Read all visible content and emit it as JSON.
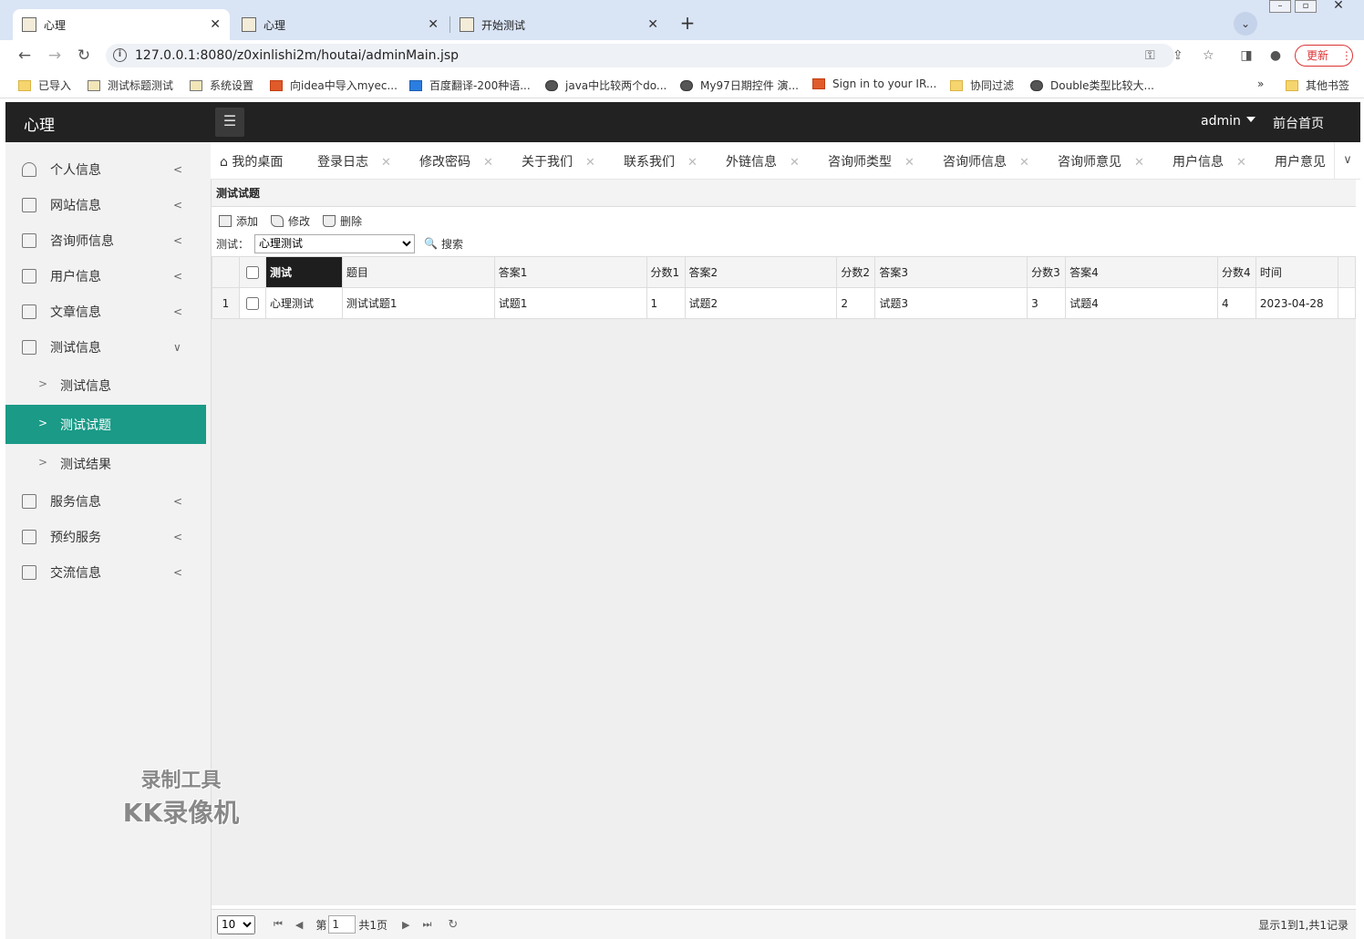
{
  "browser": {
    "tabs": [
      {
        "title": "心理",
        "close": "✕"
      },
      {
        "title": "心理",
        "close": "✕"
      },
      {
        "title": "开始测试",
        "close": "✕"
      }
    ],
    "url": "127.0.0.1:8080/z0xinlishi2m/houtai/adminMain.jsp",
    "update_label": "更新",
    "bookmarks": [
      "已导入",
      "测试标题测试",
      "系统设置",
      "向idea中导入myec...",
      "百度翻译-200种语...",
      "java中比较两个do...",
      "My97日期控件 演...",
      "Sign in to your IR...",
      "协同过滤",
      "Double类型比较大..."
    ],
    "bookmarks_overflow": "»",
    "other_bookmarks": "其他书签"
  },
  "app": {
    "title": "心理",
    "user": "admin",
    "home_link": "前台首页"
  },
  "sidebar": {
    "items": [
      {
        "label": "个人信息",
        "arrow": "<"
      },
      {
        "label": "网站信息",
        "arrow": "<"
      },
      {
        "label": "咨询师信息",
        "arrow": "<"
      },
      {
        "label": "用户信息",
        "arrow": "<"
      },
      {
        "label": "文章信息",
        "arrow": "<"
      },
      {
        "label": "测试信息",
        "arrow": "∨"
      },
      {
        "label": "服务信息",
        "arrow": "<"
      },
      {
        "label": "预约服务",
        "arrow": "<"
      },
      {
        "label": "交流信息",
        "arrow": "<"
      }
    ],
    "subitems": [
      {
        "label": "测试信息",
        "chev": ">"
      },
      {
        "label": "测试试题",
        "chev": ">"
      },
      {
        "label": "测试结果",
        "chev": ">"
      }
    ]
  },
  "page_tabs": [
    "我的桌面",
    "登录日志",
    "修改密码",
    "关于我们",
    "联系我们",
    "外链信息",
    "咨询师类型",
    "咨询师信息",
    "咨询师意见",
    "用户信息",
    "用户意见"
  ],
  "panel": {
    "title": "测试试题",
    "tools": [
      "添加",
      "修改",
      "删除"
    ],
    "search_label": "测试：",
    "search_value": "心理测试",
    "search_button": "搜索"
  },
  "grid": {
    "columns": [
      "测试",
      "题目",
      "答案1",
      "分数1",
      "答案2",
      "分数2",
      "答案3",
      "分数3",
      "答案4",
      "分数4",
      "时间"
    ],
    "rows": [
      {
        "rn": "1",
        "cells": [
          "心理测试",
          "测试试题1",
          "试题1",
          "1",
          "试题2",
          "2",
          "试题3",
          "3",
          "试题4",
          "4",
          "2023-04-28"
        ]
      }
    ]
  },
  "pager": {
    "page_size": "10",
    "page_prefix": "第",
    "page_value": "1",
    "page_total": "共1页",
    "info": "显示1到1,共1记录"
  },
  "watermark": {
    "line1": "录制工具",
    "line2": "KK录像机"
  }
}
